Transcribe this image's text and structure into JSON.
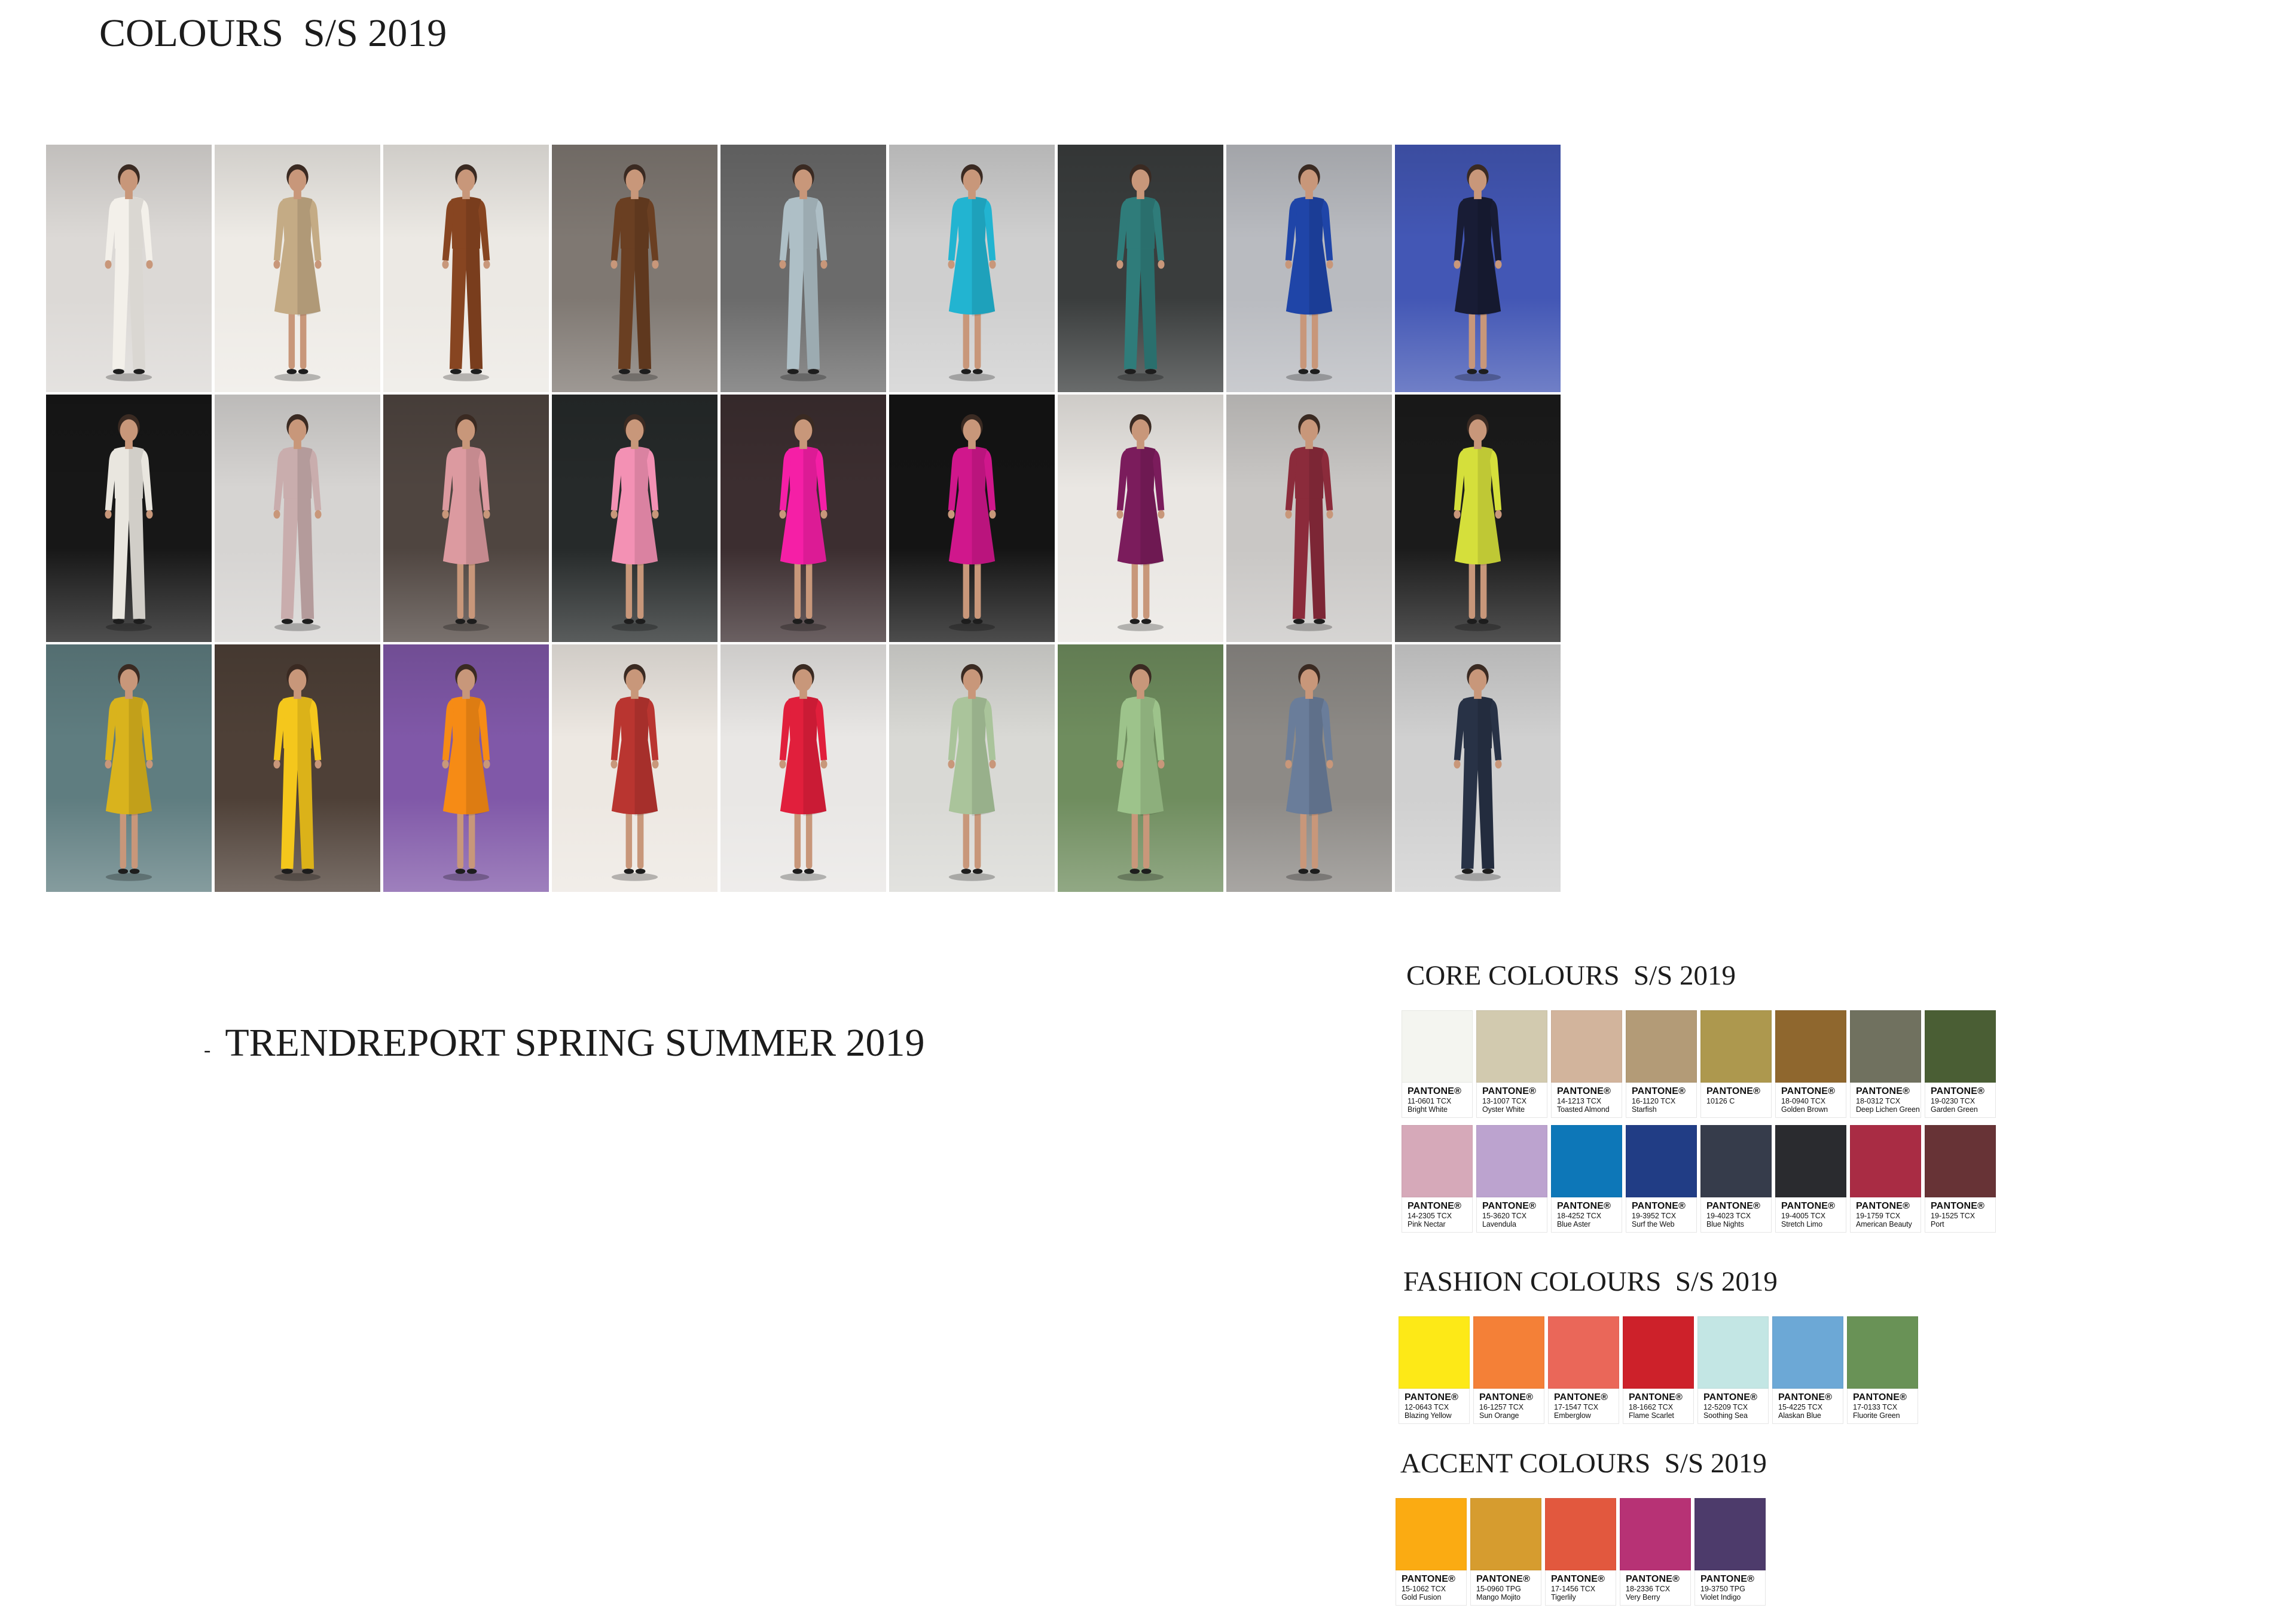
{
  "page": {
    "title": "COLOURS  S/S 2019"
  },
  "trend_report": {
    "bullet": "-",
    "label": "TRENDREPORT SPRING SUMMER 2019"
  },
  "runway_looks": [
    {
      "backdrop": "#dcd9d6",
      "outfit": "#f3f0ea"
    },
    {
      "backdrop": "#eeebe6",
      "outfit": "#c4ab85"
    },
    {
      "backdrop": "#ece9e4",
      "outfit": "#874521"
    },
    {
      "backdrop": "#7f7872",
      "outfit": "#6a3f22"
    },
    {
      "backdrop": "#6b6b6b",
      "outfit": "#aebfc6"
    },
    {
      "backdrop": "#cfcfcf",
      "outfit": "#22b4d1"
    },
    {
      "backdrop": "#3a3d3d",
      "outfit": "#2f7c7a"
    },
    {
      "backdrop": "#b9bbc0",
      "outfit": "#1f45a8"
    },
    {
      "backdrop": "#4357b5",
      "outfit": "#181c35"
    },
    {
      "backdrop": "#171717",
      "outfit": "#e9e6df"
    },
    {
      "backdrop": "#d6d4d2",
      "outfit": "#c9adad"
    },
    {
      "backdrop": "#4f4540",
      "outfit": "#dc9aa0"
    },
    {
      "backdrop": "#262a2a",
      "outfit": "#f391b4"
    },
    {
      "backdrop": "#3c2e30",
      "outfit": "#f51fa6"
    },
    {
      "backdrop": "#141414",
      "outfit": "#d0178c"
    },
    {
      "backdrop": "#eae7e3",
      "outfit": "#7b1c5c"
    },
    {
      "backdrop": "#c9c7c5",
      "outfit": "#8b2b3b"
    },
    {
      "backdrop": "#1b1b1b",
      "outfit": "#d5df3b"
    },
    {
      "backdrop": "#5f7d80",
      "outfit": "#d9b31d"
    },
    {
      "backdrop": "#4e4037",
      "outfit": "#f4c71c"
    },
    {
      "backdrop": "#8058a8",
      "outfit": "#f68b15"
    },
    {
      "backdrop": "#ede8e2",
      "outfit": "#b93530"
    },
    {
      "backdrop": "#e9e7e5",
      "outfit": "#e11f3c"
    },
    {
      "backdrop": "#d9d9d5",
      "outfit": "#aac49b"
    },
    {
      "backdrop": "#6f8d5e",
      "outfit": "#9dc38b"
    },
    {
      "backdrop": "#8d8a86",
      "outfit": "#6a7d9a"
    },
    {
      "backdrop": "#d0d0d0",
      "outfit": "#283246"
    }
  ],
  "swatch_brand": "PANTONE®",
  "palettes": {
    "core": {
      "heading": "CORE COLOURS  S/S 2019",
      "rows": [
        [
          {
            "code": "11-0601 TCX",
            "name": "Bright White",
            "hex": "#f4f5f0"
          },
          {
            "code": "13-1007 TCX",
            "name": "Oyster White",
            "hex": "#d2caaf"
          },
          {
            "code": "14-1213 TCX",
            "name": "Toasted Almond",
            "hex": "#d2b49c"
          },
          {
            "code": "16-1120 TCX",
            "name": "Starfish",
            "hex": "#b39b77"
          },
          {
            "code": "10126 C",
            "hex": "#ad984e"
          },
          {
            "code": "18-0940 TCX",
            "name": "Golden Brown",
            "hex": "#8f672e"
          },
          {
            "code": "18-0312 TCX",
            "name": "Deep Lichen Green",
            "hex": "#70715f"
          },
          {
            "code": "19-0230 TCX",
            "name": "Garden Green",
            "hex": "#4a5e34"
          }
        ],
        [
          {
            "code": "14-2305 TCX",
            "name": "Pink Nectar",
            "hex": "#d6a9b9"
          },
          {
            "code": "15-3620 TCX",
            "name": "Lavendula",
            "hex": "#bca3cf"
          },
          {
            "code": "18-4252 TCX",
            "name": "Blue Aster",
            "hex": "#0d77b8"
          },
          {
            "code": "19-3952 TCX",
            "name": "Surf the Web",
            "hex": "#213d85"
          },
          {
            "code": "19-4023 TCX",
            "name": "Blue Nights",
            "hex": "#363c4b"
          },
          {
            "code": "19-4005 TCX",
            "name": "Stretch Limo",
            "hex": "#2a2b2f"
          },
          {
            "code": "19-1759 TCX",
            "name": "American Beauty",
            "hex": "#a92c44"
          },
          {
            "code": "19-1525 TCX",
            "name": "Port",
            "hex": "#673336"
          }
        ]
      ]
    },
    "fashion": {
      "heading": "FASHION COLOURS  S/S 2019",
      "rows": [
        [
          {
            "code": "12-0643 TCX",
            "name": "Blazing Yellow",
            "hex": "#fde917"
          },
          {
            "code": "16-1257 TCX",
            "name": "Sun Orange",
            "hex": "#f48037"
          },
          {
            "code": "17-1547 TCX",
            "name": "Emberglow",
            "hex": "#ea6759"
          },
          {
            "code": "18-1662 TCX",
            "name": "Flame Scarlet",
            "hex": "#cd212a"
          },
          {
            "code": "12-5209 TCX",
            "name": "Soothing Sea",
            "hex": "#c3e6e4"
          },
          {
            "code": "15-4225 TCX",
            "name": "Alaskan Blue",
            "hex": "#6ca8d6"
          },
          {
            "code": "17-0133 TCX",
            "name": "Fluorite Green",
            "hex": "#699256"
          }
        ]
      ]
    },
    "accent": {
      "heading": "ACCENT COLOURS  S/S 2019",
      "rows": [
        [
          {
            "code": "15-1062 TCX",
            "name": "Gold Fusion",
            "hex": "#fbab12"
          },
          {
            "code": "15-0960 TPG",
            "name": "Mango Mojito",
            "hex": "#d69c2f"
          },
          {
            "code": "17-1456 TCX",
            "name": "Tigerlily",
            "hex": "#e2583e"
          },
          {
            "code": "18-2336 TCX",
            "name": "Very Berry",
            "hex": "#b73275"
          },
          {
            "code": "19-3750 TPG",
            "name": "Violet Indigo",
            "hex": "#4d3b6b"
          }
        ]
      ]
    }
  }
}
